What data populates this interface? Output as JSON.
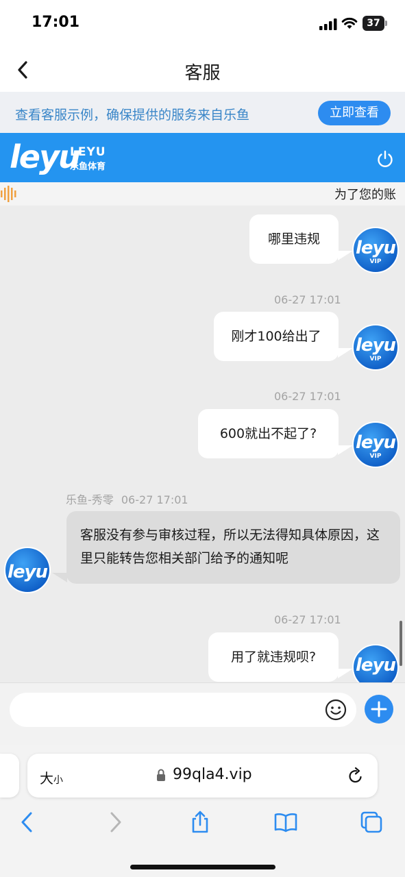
{
  "status_bar": {
    "time": "17:01",
    "battery": "37"
  },
  "header": {
    "title": "客服"
  },
  "promo": {
    "text": "查看客服示例，确保提供的服务来自乐鱼",
    "button_label": "立即查看"
  },
  "brand": {
    "logo_main": "leyu",
    "logo_en": "LEYU",
    "logo_cn": "乐鱼体育"
  },
  "marquee": {
    "text": "为了您的账"
  },
  "chat": {
    "avatar_logo": "leyu",
    "avatar_badge": "VIP",
    "messages": [
      {
        "direction": "out",
        "text": "哪里违规"
      },
      {
        "direction": "out",
        "time": "06-27 17:01",
        "text": "刚才100给出了"
      },
      {
        "direction": "out",
        "time": "06-27 17:01",
        "text": "600就出不起了?"
      },
      {
        "direction": "in",
        "sender": "乐鱼-秀零",
        "time": "06-27 17:01",
        "text": "客服没有参与审核过程，所以无法得知具体原因，这里只能转告您相关部门给予的通知呢"
      },
      {
        "direction": "out",
        "time": "06-27 17:01",
        "text": "用了就违规呗?"
      }
    ]
  },
  "input": {
    "placeholder": ""
  },
  "browser": {
    "text_size_label": "大",
    "text_size_small": "小",
    "url": "99qla4.vip"
  },
  "colors": {
    "accent": "#2d8cf0",
    "brand_bar": "#2494f0",
    "promo_text": "#3a86c8",
    "chat_bg": "#ececec"
  }
}
